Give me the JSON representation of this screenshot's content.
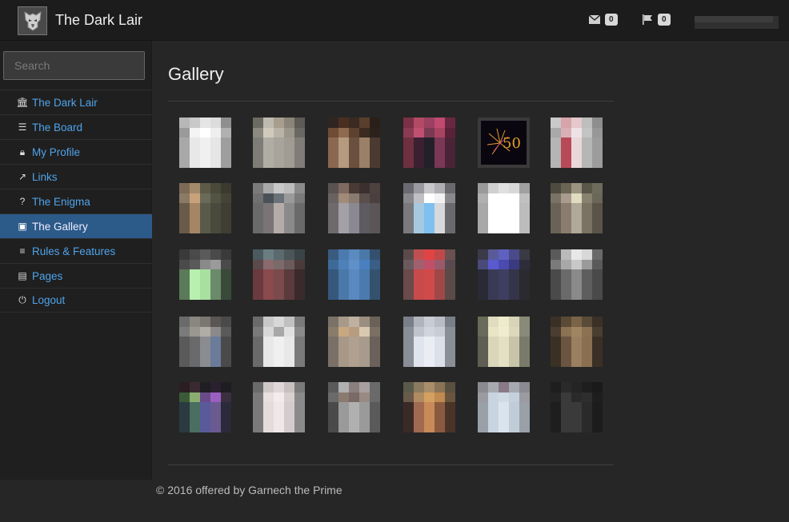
{
  "app": {
    "brand": "The Dark Lair",
    "logo_icon": "autobot-logo-icon"
  },
  "header": {
    "messages": {
      "icon": "envelope-icon",
      "count": "0"
    },
    "flags": {
      "icon": "flag-icon",
      "count": "0"
    }
  },
  "sidebar": {
    "search_placeholder": "Search",
    "items": [
      {
        "label": "The Dark Lair",
        "icon": "bank-icon",
        "active": false
      },
      {
        "label": "The Board",
        "icon": "list-icon",
        "active": false
      },
      {
        "label": "My Profile",
        "icon": "lock-icon",
        "active": false
      },
      {
        "label": "Links",
        "icon": "external-link-icon",
        "active": false
      },
      {
        "label": "The Enigma",
        "icon": "question-icon",
        "active": false
      },
      {
        "label": "The Gallery",
        "icon": "image-icon",
        "active": true
      },
      {
        "label": "Rules & Features",
        "icon": "ordered-list-icon",
        "active": false
      },
      {
        "label": "Pages",
        "icon": "file-text-icon",
        "active": false
      },
      {
        "label": "Logout",
        "icon": "power-icon",
        "active": false
      }
    ]
  },
  "main": {
    "title": "Gallery",
    "thumbnails": [
      [
        "#b7b7b7",
        "#c9c9c9",
        "#e5e5e5",
        "#dcdcdc",
        "#8f8f8f",
        "#9a9a9a",
        "#f3f3f3",
        "#ffffff",
        "#efefef",
        "#b0b0b0",
        "#a8a8a8",
        "#e8e8e8",
        "#f0f0f0",
        "#e6e6e6",
        "#9e9e9e"
      ],
      [
        "#6b6b62",
        "#bfbab0",
        "#a79e8d",
        "#8a8578",
        "#5c5a54",
        "#8c8a80",
        "#cfcabc",
        "#b8b3a6",
        "#9a968a",
        "#6a6862",
        "#7e7c76",
        "#b0ada4",
        "#a7a49c",
        "#a09c93",
        "#807d78"
      ],
      [
        "#2f2520",
        "#4a2e22",
        "#3a2a22",
        "#5a3e2c",
        "#2a201a",
        "#6e4c36",
        "#8e6a4e",
        "#5e4230",
        "#3a2a20",
        "#2c221c",
        "#8a6850",
        "#b59a80",
        "#6a503e",
        "#9a8068",
        "#4c3a30"
      ],
      [
        "#7a3046",
        "#b24a66",
        "#9a4060",
        "#c04a70",
        "#6a2840",
        "#8a3a52",
        "#c05070",
        "#7a3a52",
        "#a84462",
        "#5a2238",
        "#6e3040",
        "#3a2030",
        "#24202a",
        "#7a3854",
        "#4a2436"
      ],
      [
        "fw"
      ],
      [
        "#c9c9c9",
        "#d6a4aa",
        "#e6c8cc",
        "#bdbdbd",
        "#8e8e8e",
        "#a9a9a9",
        "#d9b0b6",
        "#efe2e4",
        "#c3c3c3",
        "#979797",
        "#b5b5b5",
        "#b84a58",
        "#e8d8da",
        "#b6b6b6",
        "#9c9c9c"
      ],
      [
        "#7d6a56",
        "#a48a6c",
        "#5e5a48",
        "#4a4a3a",
        "#3a3a30",
        "#8a7a66",
        "#c8a27a",
        "#6a6a58",
        "#545444",
        "#444436",
        "#6a5a4a",
        "#a48666",
        "#5a5a4a",
        "#4a4a3c",
        "#3e3e34"
      ],
      [
        "#7a7a7a",
        "#a8a8a8",
        "#c8c8c8",
        "#bcbcbc",
        "#8a8a8a",
        "#707070",
        "#4a5058",
        "#6a7278",
        "#9a9a9a",
        "#7a7a7a",
        "#6a6a6a",
        "#7a7476",
        "#b5acaa",
        "#8a8a8a",
        "#6a6a6a"
      ],
      [
        "#5a5250",
        "#7e6a60",
        "#4a3a36",
        "#3c302e",
        "#4e4240",
        "#6a6260",
        "#a08a78",
        "#8a7a70",
        "#5a4e4a",
        "#4a4040",
        "#6e6a6c",
        "#a4a0a8",
        "#8a8890",
        "#5e5a62",
        "#5a5658"
      ],
      [
        "#6a6a70",
        "#9a9aa0",
        "#c8c8cc",
        "#b0b0b4",
        "#6a6a6e",
        "#88888c",
        "#c0c0c4",
        "#ffffff",
        "#f2f2f2",
        "#8a8a8e",
        "#7a7a7e",
        "#a6c8e0",
        "#7ec0f0",
        "#d8d8dc",
        "#6a6a6e"
      ],
      [
        "#9a9a9a",
        "#d0d0d0",
        "#e0e0e0",
        "#d8d8d8",
        "#a0a0a0",
        "#b0b0b0",
        "#ffffff",
        "#ffffff",
        "#ffffff",
        "#c0c0c0",
        "#a8a8a8",
        "#ffffff",
        "#ffffff",
        "#ffffff",
        "#bcbcbc"
      ],
      [
        "#4e4a40",
        "#6a6454",
        "#9a9480",
        "#5a5648",
        "#6e6a5c",
        "#7a7264",
        "#a89c8e",
        "#e0dcc0",
        "#8a8270",
        "#6a6658",
        "#6a6256",
        "#8a7c6e",
        "#b0a898",
        "#7a7262",
        "#5a5448"
      ],
      [
        "#3a3a3a",
        "#4a4a4a",
        "#5a5a5a",
        "#4a4a4a",
        "#3a3a3a",
        "#4a4a4a",
        "#5a5a5a",
        "#8a8a8a",
        "#9a9a9a",
        "#4a4a4a",
        "#5a7a5a",
        "#b8f0b0",
        "#a8e0a0",
        "#6a8a6a",
        "#3a4a3a"
      ],
      [
        "#4a5a5e",
        "#6a7e82",
        "#5a6a6e",
        "#4a5658",
        "#3a4446",
        "#5a4a4c",
        "#8a6a6c",
        "#7a6a6a",
        "#6a5a5c",
        "#4a3a3c",
        "#6a3a3e",
        "#8a4a4e",
        "#7a4a4c",
        "#5a3a3c",
        "#3a2a2c"
      ],
      [
        "#3a5a80",
        "#4a7ab0",
        "#5a8ac0",
        "#4a78a8",
        "#34506e",
        "#3e6a98",
        "#5080b8",
        "#6090c8",
        "#4a80c0",
        "#3a5e86",
        "#36587c",
        "#4a78a8",
        "#5a88c0",
        "#4a7aae",
        "#34526e"
      ],
      [
        "#5a4a4a",
        "#c05050",
        "#e04444",
        "#c04848",
        "#6a5050",
        "#6a5a5e",
        "#a06070",
        "#c0506a",
        "#9a5a6a",
        "#5a4a50",
        "#6a4a4a",
        "#c84a4a",
        "#d04a4a",
        "#a04848",
        "#5a4a4a"
      ],
      [
        "#3a3a4a",
        "#5a5a9a",
        "#6060c0",
        "#4a4a8a",
        "#3a3a44",
        "#4a4a7a",
        "#5a5ad0",
        "#4a4ab0",
        "#3a3a80",
        "#2e2e3a",
        "#2a2a36",
        "#3a3a56",
        "#3e3e60",
        "#34344a",
        "#2a2a30"
      ],
      [
        "#5a5a5a",
        "#bababa",
        "#e8e8e8",
        "#d8d8d8",
        "#6a6a6a",
        "#7a7a7a",
        "#a8a8a8",
        "#c8c8c8",
        "#9a9a9a",
        "#5a5a5a",
        "#4a4a4a",
        "#6a6a6a",
        "#8a8a8a",
        "#5e5e5e",
        "#4a4a4a"
      ],
      [
        "#6a6a6a",
        "#8a8680",
        "#7a7670",
        "#5a5654",
        "#4a4a4a",
        "#7a7a7a",
        "#9a9690",
        "#b0aca6",
        "#8a8a8a",
        "#5a5a5a",
        "#5a5a5a",
        "#6a6a6c",
        "#8a8c90",
        "#6a7c9a",
        "#4a4a4a"
      ],
      [
        "#6a6a6a",
        "#c8c8c8",
        "#d8d8d8",
        "#c0c0c0",
        "#7a7a7a",
        "#7a7a7a",
        "#d8d8d8",
        "#a8a8a8",
        "#e0e0e0",
        "#8a8a8a",
        "#6a6a6a",
        "#e8e8e8",
        "#f0f0f0",
        "#e8e8e8",
        "#7a7a7a"
      ],
      [
        "#7a7268",
        "#a89a88",
        "#c0b0a0",
        "#9a8e80",
        "#6a6258",
        "#8a7c6a",
        "#c8a880",
        "#b89c80",
        "#d8c8b0",
        "#7a7064",
        "#7a7068",
        "#a89888",
        "#b0a090",
        "#a89a8c",
        "#6a625a"
      ],
      [
        "#7a7e88",
        "#b0b4bc",
        "#c8ccd4",
        "#b8bcc4",
        "#7a7e86",
        "#8a8e96",
        "#c0c4cc",
        "#d0d4dc",
        "#c8ccd4",
        "#8a8e96",
        "#8a8e96",
        "#e0e4ec",
        "#eaeef4",
        "#dce0e8",
        "#8a8e96"
      ],
      [
        "#6a6a5a",
        "#e0dcc0",
        "#eeeacc",
        "#d8d4b8",
        "#8a8a78",
        "#6a6a5c",
        "#e8e4c4",
        "#f0ecd0",
        "#dcd8bc",
        "#8a8a7a",
        "#5e5e52",
        "#dad6ba",
        "#e4e0c4",
        "#c8c4aa",
        "#7a7a6a"
      ],
      [
        "#3a3026",
        "#5a4a36",
        "#7a6448",
        "#5a4a38",
        "#3a3026",
        "#4a3e30",
        "#8a7252",
        "#a08660",
        "#8a7252",
        "#4a3e30",
        "#3a3024",
        "#6a5640",
        "#9a8060",
        "#8a7050",
        "#3a3026"
      ],
      [
        "#2a1e22",
        "#3a2a30",
        "#1e1e24",
        "#2a2030",
        "#1e1e22",
        "#3a5a3a",
        "#8aae70",
        "#6a4a8a",
        "#9a60c0",
        "#3a3040",
        "#2a3a40",
        "#4a6e60",
        "#5a5a9a",
        "#6a5a90",
        "#2a2a3a"
      ],
      [
        "#6a6a6a",
        "#d0c8c8",
        "#e0d8d8",
        "#c8c0c0",
        "#7a7a7a",
        "#7a7a7a",
        "#e8e0e0",
        "#f4ecec",
        "#d8d0d0",
        "#8a8a8a",
        "#7a7a7a",
        "#e4dcdc",
        "#f0e8e8",
        "#d4cccc",
        "#8a8a8a"
      ],
      [
        "#5a5a5a",
        "#b0b0b0",
        "#8a7e7e",
        "#a8a0a0",
        "#6a6a6a",
        "#6a6a6a",
        "#8a7a70",
        "#7a6a66",
        "#9a8a84",
        "#6a6a6a",
        "#4a4a4a",
        "#9a9a9a",
        "#b0b0b0",
        "#9a9a9a",
        "#5a5a5a"
      ],
      [
        "#5a5a4a",
        "#8a7a60",
        "#a88e6a",
        "#8a7456",
        "#5a5040",
        "#6a5a4a",
        "#b08a60",
        "#d4a060",
        "#c08a50",
        "#6a5440",
        "#3a2a26",
        "#a06a50",
        "#c88a58",
        "#8a5a40",
        "#4a3428"
      ],
      [
        "#8a8a90",
        "#a8aab0",
        "#8a7a88",
        "#a8a8b0",
        "#8a8a90",
        "#9a9aa0",
        "#c8d4e0",
        "#d0dae4",
        "#c4d0dc",
        "#9a9aa0",
        "#9aa0a8",
        "#c8d4e0",
        "#dae4ee",
        "#c0ccd8",
        "#9aa0a8"
      ],
      [
        "#1e1e1e",
        "#2a2a2a",
        "#242424",
        "#1e1e1e",
        "#1a1a1a",
        "#242424",
        "#3a3a3a",
        "#2a2a2a",
        "#2e2e2e",
        "#1e1e1e",
        "#1e1e1e",
        "#3a3a3a",
        "#3a3a3a",
        "#2a2a2a",
        "#1c1c1c"
      ]
    ]
  },
  "footer": {
    "copyright": "© 2016 offered by Garnech the Prime"
  }
}
